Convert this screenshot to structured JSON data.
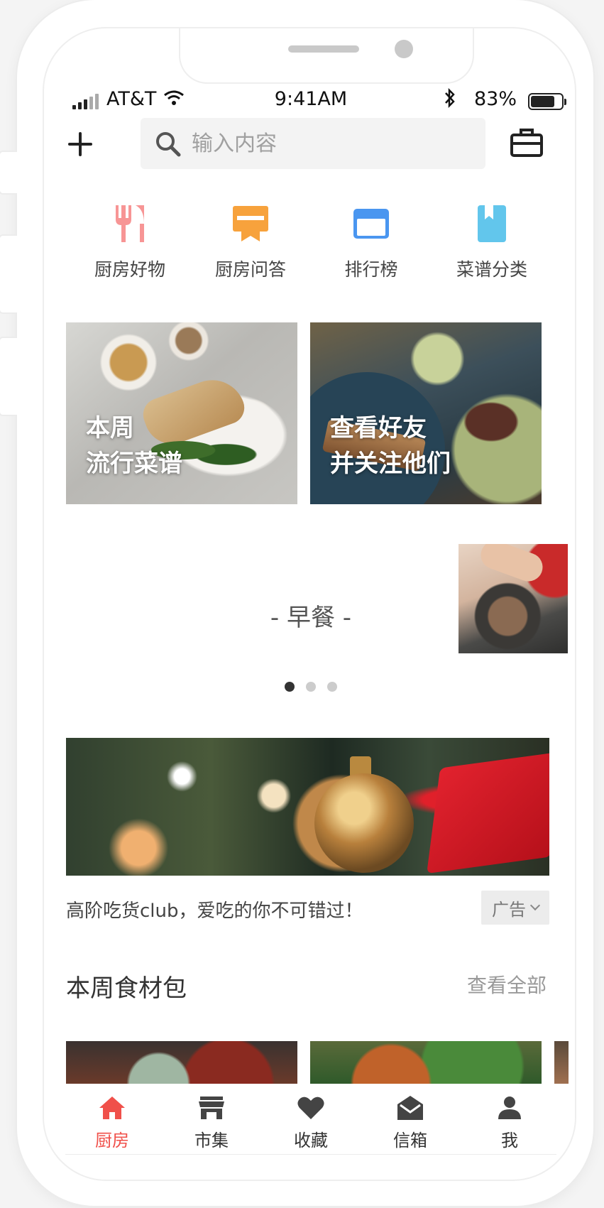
{
  "status_bar": {
    "carrier": "AT&T",
    "time": "9:41AM",
    "battery": "83%",
    "battery_level": 0.83
  },
  "header": {
    "search_placeholder": "输入内容",
    "icons": [
      "plus-icon",
      "search-icon",
      "briefcase-icon"
    ]
  },
  "categories": [
    {
      "label": "厨房好物",
      "icon": "fork-knife-icon",
      "color": "#f79595"
    },
    {
      "label": "厨房问答",
      "icon": "qa-badge-icon",
      "color": "#f7a23c"
    },
    {
      "label": "排行榜",
      "icon": "card-icon",
      "color": "#4a96f0"
    },
    {
      "label": "菜谱分类",
      "icon": "bookmark-book-icon",
      "color": "#62c6ec"
    }
  ],
  "featured": [
    {
      "line1": "本周",
      "line2": "流行菜谱"
    },
    {
      "line1": "查看好友",
      "line2": "并关注他们"
    }
  ],
  "carousel": {
    "title": "- 早餐 -",
    "pages": 3,
    "active_index": 0
  },
  "ad": {
    "text": "高阶吃货club，爱吃的你不可错过！",
    "badge": "广告"
  },
  "section": {
    "title": "本周食材包",
    "more": "查看全部"
  },
  "tabs": [
    {
      "label": "厨房",
      "icon": "home-icon",
      "active": true
    },
    {
      "label": "市集",
      "icon": "store-icon",
      "active": false
    },
    {
      "label": "收藏",
      "icon": "heart-icon",
      "active": false
    },
    {
      "label": "信箱",
      "icon": "mail-icon",
      "active": false
    },
    {
      "label": "我",
      "icon": "user-icon",
      "active": false
    }
  ],
  "colors": {
    "accent": "#f0504a",
    "text": "#333333",
    "muted": "#999999"
  }
}
